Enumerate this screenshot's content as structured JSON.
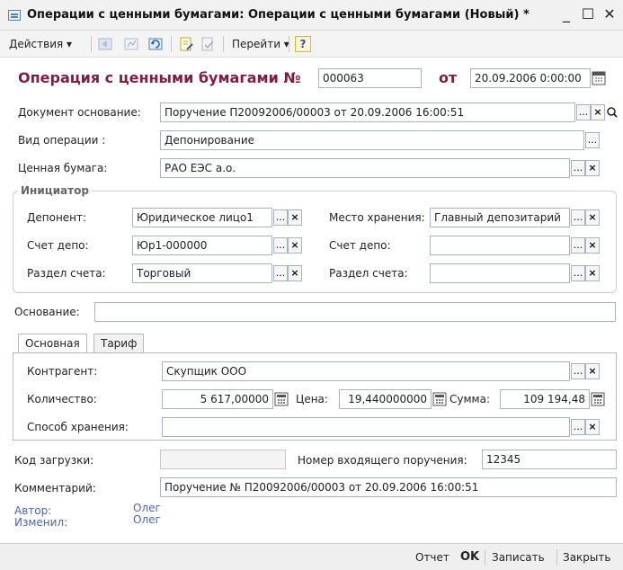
{
  "window": {
    "title": "Операции с ценными бумагами: Операции с ценными бумагами (Новый) *",
    "minimize": "_",
    "maximize": "☐",
    "close": "✕"
  },
  "toolbar": {
    "actions_label": "Действия ▾",
    "goto_label": "Перейти ▾",
    "help_label": "?"
  },
  "header": {
    "title": "Операция с ценными бумагами №",
    "number": "000063",
    "date_label": "от",
    "date": "20.09.2006 0:00:00"
  },
  "doc_base": {
    "label": "Документ основание:",
    "value": "Поручение П20092006/00003 от 20.09.2006 16:00:51"
  },
  "op_type": {
    "label": "Вид операции :",
    "value": "Депонирование"
  },
  "security": {
    "label": "Ценная бумага:",
    "value": "РАО ЕЭС а.о."
  },
  "initiator": {
    "title": "Инициатор",
    "depositor_label": "Депонент:",
    "depositor_value": "Юридическое лицо1",
    "account_label": "Счет депо:",
    "account_value": "Юр1-000000",
    "section_label": "Раздел счета:",
    "section_value": "Торговый",
    "storage_label": "Место хранения:",
    "storage_value": "Главный депозитарий",
    "account2_label": "Счет депо:",
    "account2_value": "",
    "section2_label": "Раздел счета:",
    "section2_value": ""
  },
  "basis": {
    "label": "Основание:",
    "value": ""
  },
  "tabs": {
    "main": "Основная",
    "tariff": "Тариф"
  },
  "main_tab": {
    "counterparty_label": "Контрагент:",
    "counterparty_value": "Скупщик ООО",
    "qty_label": "Количество:",
    "qty_value": "5 617,00000",
    "price_label": "Цена:",
    "price_value": "19,440000000",
    "sum_label": "Сумма:",
    "sum_value": "109 194,48",
    "storage_method_label": "Способ хранения:",
    "storage_method_value": ""
  },
  "bottom_fields": {
    "load_code_label": "Код загрузки:",
    "load_code_value": "",
    "incoming_order_label": "Номер входящего поручения:",
    "incoming_order_value": "12345",
    "comment_label": "Комментарий:",
    "comment_value": "Поручение № П20092006/00003 от 20.09.2006 16:00:51"
  },
  "meta": {
    "author_label": "Автор:",
    "author_value": "Олег",
    "editor_label": "Изменил:",
    "editor_value": "Олег"
  },
  "footer": {
    "report": "Отчет",
    "ok": "OK",
    "save": "Записать",
    "close": "Закрыть"
  },
  "select_glyph": "...",
  "clear_glyph": "×"
}
